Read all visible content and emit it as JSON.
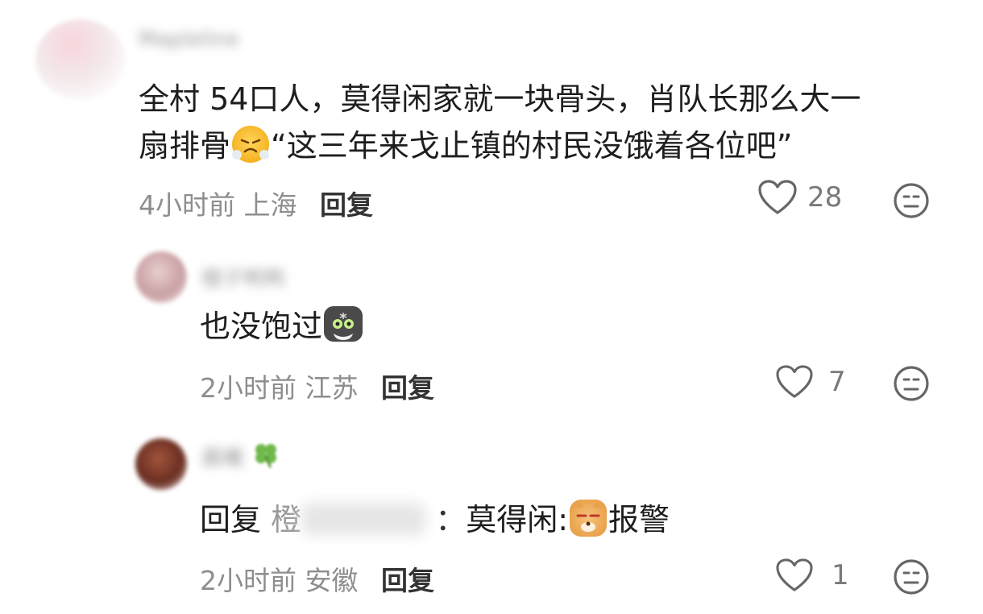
{
  "comments": [
    {
      "username": "Mapleline",
      "text_part1": "全村 54口人，莫得闲家就一块骨头，肖队长那么大一",
      "text_part2_a": "扇排骨",
      "emoji": "steam-face-emoji",
      "text_part2_b": "“这三年来戈止镇的村民没饿着各位吧”",
      "time": "4小时前",
      "location": "上海",
      "reply_label": "回复",
      "likes": "28"
    }
  ],
  "replies": [
    {
      "username": "橙子鸭鸭",
      "text": "也没饱过",
      "emoji": "cat-emoji",
      "time": "2小时前",
      "location": "江苏",
      "reply_label": "回复",
      "likes": "7"
    },
    {
      "username": "晨曦",
      "reply_prefix": "回复",
      "reply_target": "橙",
      "colon": "：",
      "text_a": "莫得闲:",
      "emoji": "dog-emoji",
      "text_b": "报警",
      "time": "2小时前",
      "location": "安徽",
      "reply_label": "回复",
      "likes": "1"
    }
  ],
  "icons": {
    "like": "heart-outline-icon",
    "dislike": "neutral-face-icon"
  },
  "colors": {
    "text": "#1e1e1e",
    "meta": "#8e8e8e",
    "icon": "#666666"
  }
}
